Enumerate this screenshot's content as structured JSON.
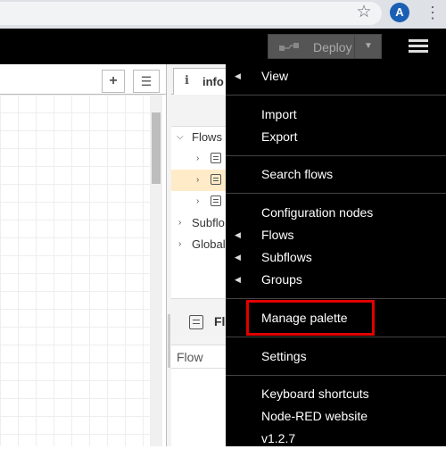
{
  "browser": {
    "star_icon": "star-icon",
    "profile_initial": "A",
    "menu_icon": "kebab-menu-icon"
  },
  "header": {
    "deploy_label": "Deploy"
  },
  "sidebar": {
    "info_tab_label": "info",
    "tree": [
      {
        "label": "Flows",
        "expanded": true
      },
      {
        "label": "",
        "type": "flow"
      },
      {
        "label": "",
        "type": "flow",
        "selected": true
      },
      {
        "label": "",
        "type": "flow"
      },
      {
        "label": "Subflo",
        "expanded": false
      },
      {
        "label": "Global",
        "expanded": false
      }
    ],
    "panel_title": "Fl",
    "panel_row_label": "Flow"
  },
  "menu": {
    "items": [
      {
        "label": "View",
        "submenu": true
      },
      {
        "label": "Import",
        "submenu": false
      },
      {
        "label": "Export",
        "submenu": false
      },
      {
        "label": "Search flows",
        "submenu": false
      },
      {
        "label": "Configuration nodes",
        "submenu": false
      },
      {
        "label": "Flows",
        "submenu": true
      },
      {
        "label": "Subflows",
        "submenu": true
      },
      {
        "label": "Groups",
        "submenu": true
      },
      {
        "label": "Manage palette",
        "submenu": false,
        "highlighted": true
      },
      {
        "label": "Settings",
        "submenu": false
      },
      {
        "label": "Keyboard shortcuts",
        "submenu": false
      },
      {
        "label": "Node-RED website",
        "submenu": false
      },
      {
        "label": "v1.2.7",
        "submenu": false
      }
    ],
    "highlight_color": "#e00000"
  }
}
